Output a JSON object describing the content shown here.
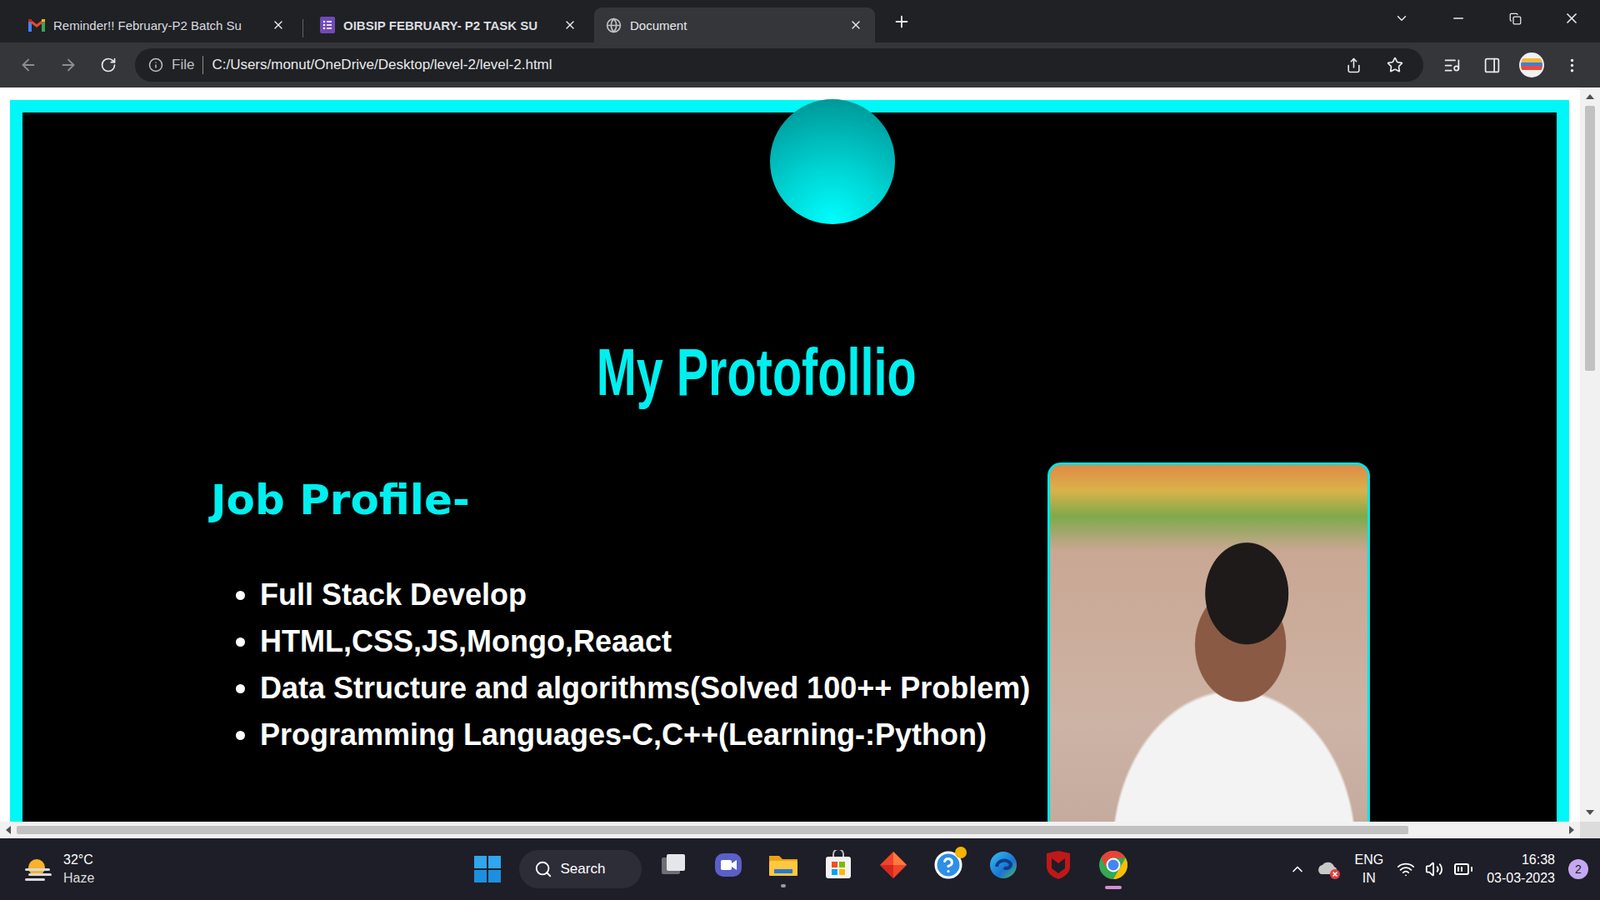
{
  "browser": {
    "tabs": [
      {
        "label": "Reminder!! February-P2 Batch Su",
        "selected": false,
        "kind": "gmail"
      },
      {
        "label": "OIBSIP FEBRUARY- P2 TASK SU",
        "selected": false,
        "kind": "forms"
      },
      {
        "label": "Document",
        "selected": true,
        "kind": "globe"
      }
    ],
    "address_bar": {
      "scheme_label": "File",
      "url": "C:/Users/monut/OneDrive/Desktop/level-2/level-2.html"
    },
    "scrollbars": {
      "vertical": {
        "start": 0.0,
        "level": 0.38
      },
      "horizontal": {
        "start": 0.0,
        "level": 0.9
      }
    }
  },
  "page": {
    "title": "My Protofollio",
    "section_heading": "Job Profile-",
    "items": [
      "Full Stack Develop",
      "HTML,CSS,JS,Mongo,Reaact",
      "Data Structure and algorithms(Solved 100++ Problem)",
      "Programming Languages-C,C++(Learning-:Python)"
    ]
  },
  "taskbar": {
    "weather": {
      "temperature": "32°C",
      "condition": "Haze"
    },
    "search": {
      "label": "Search"
    },
    "apps": [
      {
        "kind": "task-view",
        "running": false,
        "selected": false
      },
      {
        "kind": "teams",
        "running": false,
        "selected": false
      },
      {
        "kind": "explorer",
        "running": true,
        "selected": false
      },
      {
        "kind": "store",
        "running": false,
        "selected": false
      },
      {
        "kind": "red-app",
        "running": false,
        "selected": false
      },
      {
        "kind": "help",
        "running": false,
        "selected": false
      },
      {
        "kind": "edge",
        "running": false,
        "selected": false
      },
      {
        "kind": "mcafee",
        "running": false,
        "selected": false
      },
      {
        "kind": "chrome",
        "running": true,
        "selected": true
      }
    ],
    "tray": {
      "language": "ENG",
      "region": "IN",
      "time": "16:38",
      "date": "03-03-2023",
      "notifications": "2"
    }
  }
}
